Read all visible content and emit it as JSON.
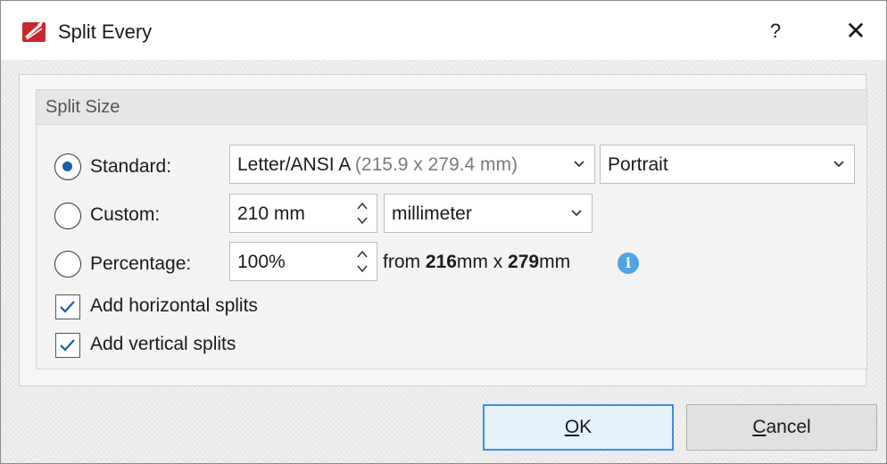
{
  "window": {
    "title": "Split Every",
    "help_label": "?",
    "close_label": "✕"
  },
  "group": {
    "title": "Split Size"
  },
  "standard": {
    "label": "Standard:",
    "selected": true,
    "size_value": "Letter/ANSI A",
    "size_detail": " (215.9 x 279.4 mm)",
    "orientation_value": "Portrait"
  },
  "custom": {
    "label": "Custom:",
    "selected": false,
    "value": "210 mm",
    "unit_value": "millimeter"
  },
  "percentage": {
    "label": "Percentage:",
    "selected": false,
    "value": "100%",
    "from_prefix": "from ",
    "from_width": "216",
    "from_mid": "mm x ",
    "from_height": "279",
    "from_suffix": "mm"
  },
  "options": {
    "horizontal_label": "Add horizontal splits",
    "horizontal_checked": true,
    "vertical_label": "Add vertical splits",
    "vertical_checked": true
  },
  "buttons": {
    "ok_mnemonic": "O",
    "ok_rest": "K",
    "cancel_mnemonic": "C",
    "cancel_rest": "ancel"
  },
  "icons": {
    "app": "pdf-editor-icon",
    "info": "info-icon",
    "dropdown": "chevron-down-icon",
    "spinner": "spinner-arrows-icon",
    "check": "checkmark-icon"
  },
  "colors": {
    "accent": "#1b5fa8",
    "info": "#4fa3e6",
    "default_button_border": "#3d8ee0",
    "app_icon_red": "#c8282c"
  }
}
